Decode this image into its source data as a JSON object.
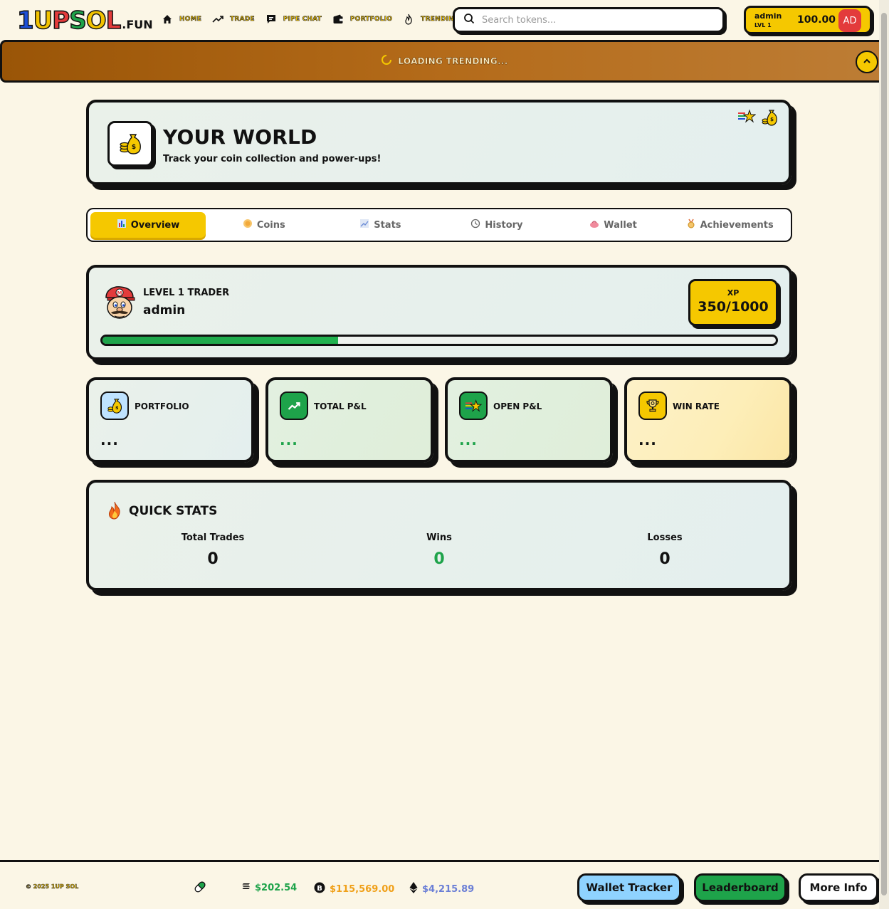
{
  "brand": {
    "logo_main": "1UPSOL",
    "logo_suffix": ".FUN"
  },
  "nav": [
    {
      "icon": "home-icon",
      "label": "HOME"
    },
    {
      "icon": "trending-up-icon",
      "label": "TRADE"
    },
    {
      "icon": "chat-icon",
      "label": "PIPE CHAT"
    },
    {
      "icon": "wallet-icon",
      "label": "PORTFOLIO"
    },
    {
      "icon": "flame-icon",
      "label": "TRENDING"
    }
  ],
  "search": {
    "placeholder": "Search tokens...",
    "value": ""
  },
  "user": {
    "name": "admin",
    "level": "LVL 1",
    "balance": "100.00",
    "initials": "AD"
  },
  "ticker": {
    "text": "LOADING TRENDING..."
  },
  "hero": {
    "title": "YOUR WORLD",
    "subtitle": "Track your coin collection and power-ups!"
  },
  "tabs": [
    {
      "icon": "bar-chart-icon",
      "label": "Overview",
      "active": true
    },
    {
      "icon": "coin-icon",
      "label": "Coins"
    },
    {
      "icon": "line-chart-icon",
      "label": "Stats"
    },
    {
      "icon": "clock-icon",
      "label": "History"
    },
    {
      "icon": "purse-icon",
      "label": "Wallet"
    },
    {
      "icon": "medal-icon",
      "label": "Achievements"
    }
  ],
  "profile": {
    "level_label": "LEVEL 1 TRADER",
    "name": "admin",
    "xp_label": "XP",
    "xp_value": "350/1000",
    "xp_fraction": 0.35
  },
  "stats": [
    {
      "icon": "money-bag-icon",
      "label": "PORTFOLIO",
      "value": "...",
      "color": "#111111"
    },
    {
      "icon": "trending-up-icon",
      "label": "TOTAL P&L",
      "value": "...",
      "color": "#1ea34a"
    },
    {
      "icon": "shooting-star-icon",
      "label": "OPEN P&L",
      "value": "...",
      "color": "#1ea34a"
    },
    {
      "icon": "trophy-icon",
      "label": "WIN RATE",
      "value": "...",
      "color": "#111111"
    }
  ],
  "quick_stats": {
    "title": "QUICK STATS",
    "items": [
      {
        "label": "Total Trades",
        "value": "0",
        "color": "#111111"
      },
      {
        "label": "Wins",
        "value": "0",
        "color": "#1ea34a"
      },
      {
        "label": "Losses",
        "value": "0",
        "color": "#111111"
      }
    ]
  },
  "footer": {
    "copyright": "© 2025 1UP SOL",
    "prices": [
      {
        "icon": "solana-icon",
        "value": "$202.54",
        "color": "#1ea34a"
      },
      {
        "icon": "bitcoin-icon",
        "value": "$115,569.00",
        "color": "#f0a019"
      },
      {
        "icon": "ethereum-icon",
        "value": "$4,215.89",
        "color": "#6b7fd6"
      }
    ],
    "buttons": [
      {
        "label": "Wallet Tracker",
        "color": "#8fd3ff"
      },
      {
        "label": "Leaderboard",
        "color": "#1ea34a"
      },
      {
        "label": "More Info",
        "color": "#ffffff"
      }
    ]
  }
}
